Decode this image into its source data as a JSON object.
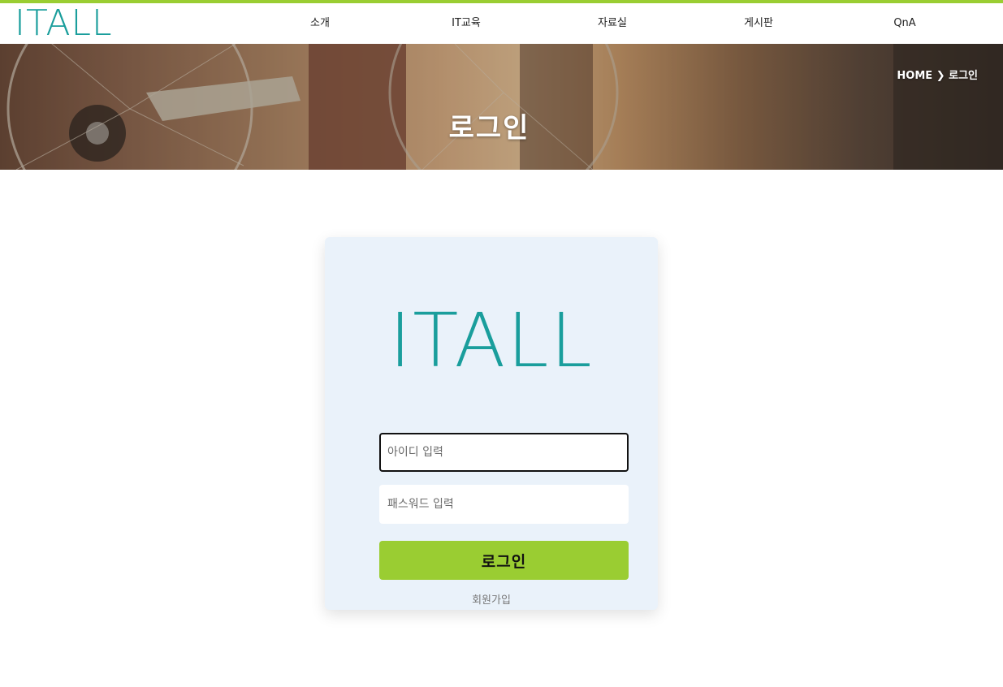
{
  "header": {
    "logo": "ITALL",
    "nav": [
      {
        "label": "소개"
      },
      {
        "label": "IT교육"
      },
      {
        "label": "자료실"
      },
      {
        "label": "게시판"
      },
      {
        "label": "QnA"
      }
    ]
  },
  "hero": {
    "title": "로그인",
    "breadcrumb": "HOME ❯ 로그인"
  },
  "login": {
    "logo": "ITALL",
    "id_placeholder": "아이디 입력",
    "id_value": "",
    "password_placeholder": "패스워드 입력",
    "password_value": "",
    "submit_label": "로그인",
    "signup_label": "회원가입"
  },
  "colors": {
    "accent": "#9acd32",
    "brand": "#1a9e9c",
    "card_bg": "#eaf2fa"
  }
}
